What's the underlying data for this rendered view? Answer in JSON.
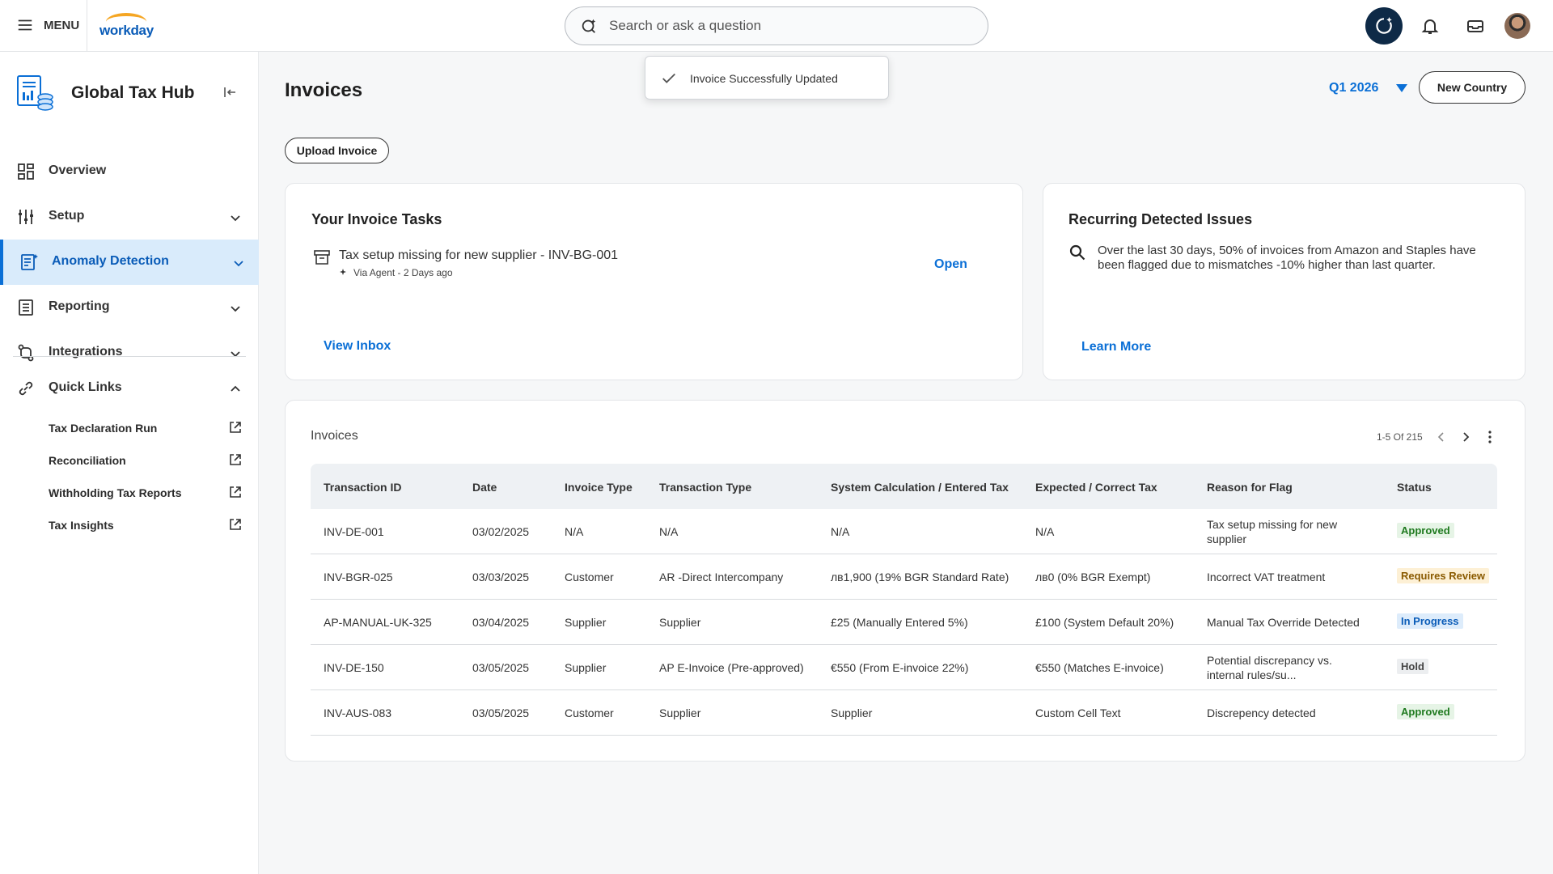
{
  "topbar": {
    "menu_label": "MENU",
    "logo_text": "workday",
    "search_placeholder": "Search or ask a question"
  },
  "toast": {
    "message": "Invoice Successfully Updated"
  },
  "sidebar": {
    "app_title": "Global Tax Hub",
    "items": [
      {
        "label": "Overview",
        "icon": "grid-icon"
      },
      {
        "label": "Setup",
        "icon": "sliders-icon"
      },
      {
        "label": "Anomaly Detection",
        "icon": "document-sparkle-icon"
      },
      {
        "label": "Reporting",
        "icon": "report-icon"
      },
      {
        "label": "Integrations",
        "icon": "integration-icon"
      }
    ],
    "quick_links_label": "Quick Links",
    "quick_links": [
      {
        "label": "Tax Declaration Run"
      },
      {
        "label": "Reconciliation"
      },
      {
        "label": "Withholding Tax Reports"
      },
      {
        "label": "Tax Insights"
      }
    ]
  },
  "main": {
    "title": "Invoices",
    "period": "Q1 2026",
    "new_country_label": "New Country",
    "upload_label": "Upload Invoice"
  },
  "tasks_card": {
    "title": "Your Invoice Tasks",
    "task_title": "Tax setup missing for new supplier - INV-BG-001",
    "task_meta": "Via Agent - 2 Days ago",
    "open_label": "Open",
    "view_inbox_label": "View Inbox"
  },
  "issues_card": {
    "title": "Recurring Detected Issues",
    "text": "Over the last 30 days, 50% of invoices from Amazon and Staples have been flagged due to mismatches -10% higher than last quarter.",
    "learn_more_label": "Learn More"
  },
  "table": {
    "title": "Invoices",
    "pager_text": "1-5 Of 215",
    "columns": [
      "Transaction ID",
      "Date",
      "Invoice Type",
      "Transaction Type",
      "System Calculation / Entered Tax",
      "Expected / Correct Tax",
      "Reason for Flag",
      "Status"
    ],
    "rows": [
      {
        "id": "INV-DE-001",
        "date": "03/02/2025",
        "invoice_type": "N/A",
        "transaction_type": "N/A",
        "system_tax": "N/A",
        "expected_tax": "N/A",
        "reason": "Tax setup missing for new supplier",
        "status": "Approved",
        "status_kind": "approved"
      },
      {
        "id": "INV-BGR-025",
        "date": "03/03/2025",
        "invoice_type": "Customer",
        "transaction_type": "AR -Direct Intercompany",
        "system_tax": "лв1,900 (19% BGR Standard Rate)",
        "expected_tax": "лв0 (0% BGR Exempt)",
        "reason": "Incorrect VAT treatment",
        "status": "Requires Review",
        "status_kind": "review"
      },
      {
        "id": "AP-MANUAL-UK-325",
        "date": "03/04/2025",
        "invoice_type": "Supplier",
        "transaction_type": "Supplier",
        "system_tax": "£25 (Manually Entered 5%)",
        "expected_tax": "£100 (System Default 20%)",
        "reason": "Manual Tax Override Detected",
        "status": "In Progress",
        "status_kind": "progress"
      },
      {
        "id": "INV-DE-150",
        "date": "03/05/2025",
        "invoice_type": "Supplier",
        "transaction_type": "AP E-Invoice (Pre-approved)",
        "system_tax": "€550 (From E-invoice 22%)",
        "expected_tax": "€550 (Matches E-invoice)",
        "reason": "Potential discrepancy vs. internal rules/su...",
        "status": "Hold",
        "status_kind": "hold"
      },
      {
        "id": "INV-AUS-083",
        "date": "03/05/2025",
        "invoice_type": "Customer",
        "transaction_type": "Supplier",
        "system_tax": "Supplier",
        "expected_tax": "Custom Cell Text",
        "reason": "Discrepency detected",
        "status": "Approved",
        "status_kind": "approved"
      }
    ]
  },
  "colors": {
    "accent": "#0a6fd6",
    "approved_bg": "#e6f4e6",
    "approved_fg": "#1f7a1f",
    "review_bg": "#fdf0d5",
    "review_fg": "#8a5a00",
    "progress_bg": "#ddecfb",
    "progress_fg": "#0a5cb8",
    "hold_bg": "#eceef0",
    "hold_fg": "#444444"
  }
}
